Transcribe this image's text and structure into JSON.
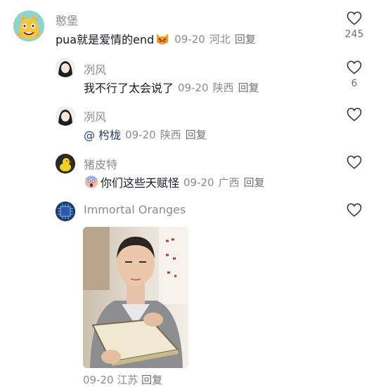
{
  "comments": [
    {
      "username": "憨堡",
      "text": "pua就是爱情的end",
      "emoji": "cat-emoji",
      "date": "09-20",
      "location": "河北",
      "reply": "回复",
      "likes": "245"
    },
    {
      "username": "冽风",
      "text": "我不行了太会说了",
      "date": "09-20",
      "location": "陕西",
      "reply": "回复",
      "likes": "6"
    },
    {
      "username": "冽风",
      "mention": "@ 枍栊",
      "date": "09-20",
      "location": "陕西",
      "reply": "回复"
    },
    {
      "username": "猪皮特",
      "emoji": "scream-emoji",
      "text": "你们这些天赋怪",
      "date": "09-20",
      "location": "广西",
      "reply": "回复"
    },
    {
      "username": "Immortal Oranges",
      "image": "photo-of-man-reading-book",
      "date": "09-20",
      "location": "江苏",
      "reply": "回复"
    }
  ],
  "colors": {
    "text": "#161823",
    "muted": "#8a8b91",
    "mention": "#2a3d66"
  },
  "icons": {
    "like": "heart-outline-icon"
  }
}
